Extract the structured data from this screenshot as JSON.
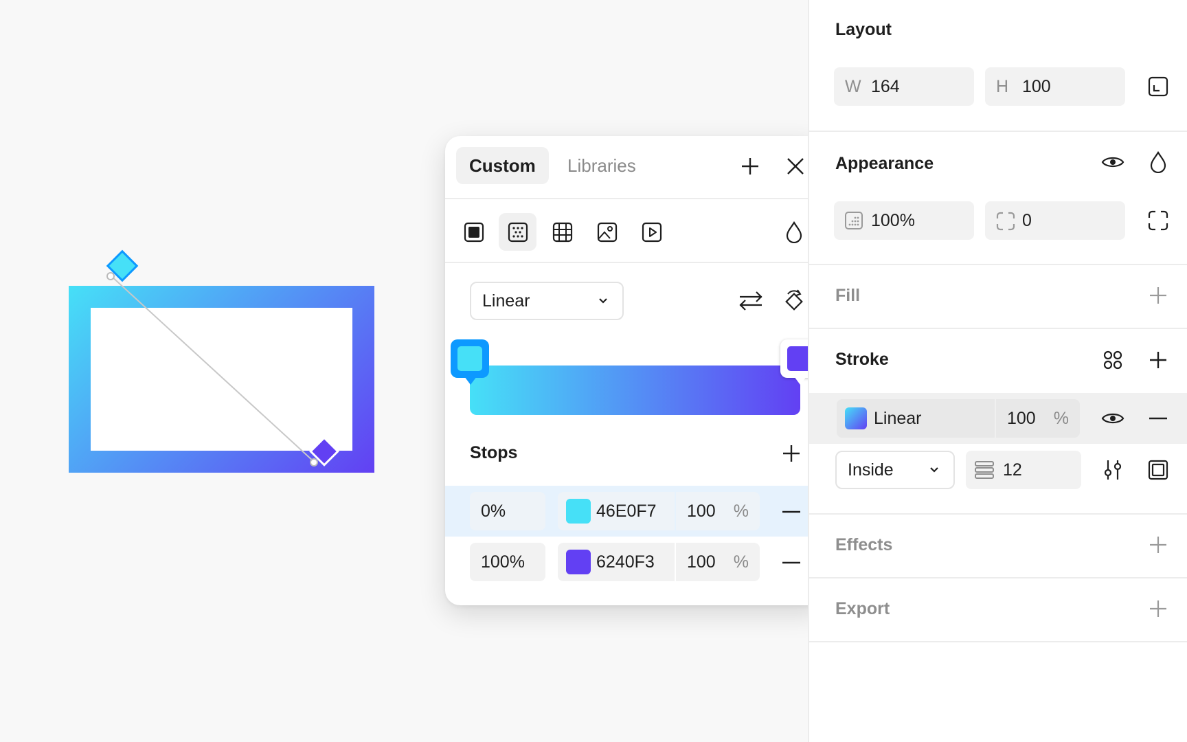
{
  "picker": {
    "tabs": {
      "custom": "Custom",
      "libraries": "Libraries"
    },
    "fill_types": [
      "solid-fill-icon",
      "gradient-fill-icon",
      "pattern-fill-icon",
      "image-fill-icon",
      "video-fill-icon"
    ],
    "gradient_type": "Linear",
    "stops_label": "Stops",
    "stops": [
      {
        "position": "0%",
        "hex": "46E0F7",
        "color": "#46E0F7",
        "opacity": "100",
        "unit": "%"
      },
      {
        "position": "100%",
        "hex": "6240F3",
        "color": "#6240F3",
        "opacity": "100",
        "unit": "%"
      }
    ]
  },
  "panel": {
    "layout": {
      "title": "Layout",
      "w_label": "W",
      "w_value": "164",
      "h_label": "H",
      "h_value": "100"
    },
    "appearance": {
      "title": "Appearance",
      "opacity": "100%",
      "corner_radius": "0"
    },
    "fill": {
      "title": "Fill"
    },
    "stroke": {
      "title": "Stroke",
      "paint": "Linear",
      "opacity": "100",
      "unit": "%",
      "align": "Inside",
      "weight": "12"
    },
    "effects": {
      "title": "Effects"
    },
    "export": {
      "title": "Export"
    }
  },
  "colors": {
    "accent": "#0d99ff",
    "gradient_start": "#46E0F7",
    "gradient_end": "#6240F3"
  }
}
